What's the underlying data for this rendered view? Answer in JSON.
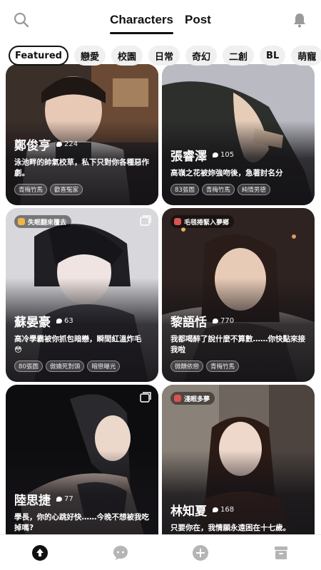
{
  "header": {
    "tabs": [
      "Characters",
      "Post"
    ],
    "search_icon": "search-icon",
    "bell_icon": "bell-icon"
  },
  "categories": [
    "Featured",
    "戀愛",
    "校園",
    "日常",
    "奇幻",
    "二創",
    "BL",
    "萌寵"
  ],
  "cards": [
    {
      "name": "鄭俊亨",
      "count": "224",
      "desc": "泳池畔的帥氣校草，私下只對你各種惡作劇。",
      "tags": [
        "青梅竹馬",
        "歡喜冤家"
      ]
    },
    {
      "name": "張睿澤",
      "count": "105",
      "desc": "高嶺之花被妳強吻後，急著討名分",
      "tags": [
        "83張圖",
        "青梅竹馬",
        "純情男德"
      ]
    },
    {
      "badge": "失眠翻來覆去",
      "name": "蘇晏豪",
      "count": "63",
      "desc": "高冷學霸被你抓包暗戀，瞬間紅溫炸毛 😳",
      "tags": [
        "80張圖",
        "傲嬌死對頭",
        "暗戀曝光"
      ]
    },
    {
      "badge": "毛毯捲緊入夢鄉",
      "name": "黎語恬",
      "count": "770",
      "desc": "我都喝醉了說什麼不算數……你快點來接我啦",
      "tags": [
        "微醺依戀",
        "青梅竹馬"
      ]
    },
    {
      "name": "陸思捷",
      "count": "77",
      "desc": "學長，你的心跳好快……今晚不想被我吃掉嗎?",
      "tags": []
    },
    {
      "badge": "淺眠多夢",
      "name": "林知夏",
      "count": "168",
      "desc": "只要你在，我情願永遠困在十七歲。",
      "tags": []
    }
  ],
  "bottom_nav": [
    "home-icon",
    "chat-icon",
    "create-icon",
    "archive-icon"
  ],
  "colors": {
    "accent": "#111111",
    "chip_bg": "#f0f0f0",
    "card_overlay": "#141216"
  }
}
